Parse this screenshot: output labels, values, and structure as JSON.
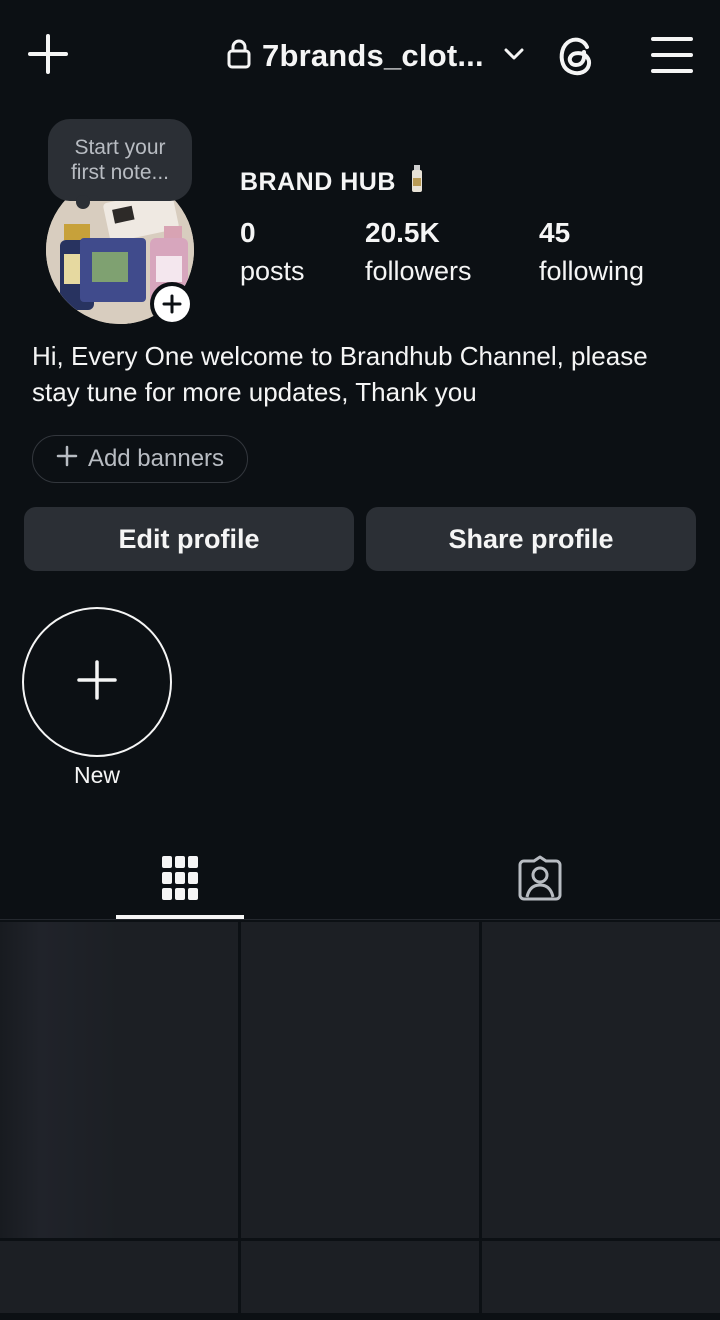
{
  "header": {
    "username": "7brands_clot...",
    "icons": [
      "plus-icon",
      "lock-icon",
      "chevron-down-icon",
      "threads-icon",
      "menu-icon"
    ]
  },
  "profile": {
    "note": "Start your first note...",
    "display_name": "BRAND HUB",
    "stats": [
      {
        "value": "0",
        "label": "posts"
      },
      {
        "value": "20.5K",
        "label": "followers"
      },
      {
        "value": "45",
        "label": "following"
      }
    ],
    "bio": "Hi, Every One welcome to Brandhub Channel, please stay tune for more updates, Thank you",
    "add_banners": "Add banners"
  },
  "actions": {
    "edit": "Edit profile",
    "share": "Share profile"
  },
  "highlights": {
    "new_label": "New"
  },
  "tabs": {
    "items": [
      "grid-icon",
      "tagged-icon"
    ],
    "active": "grid-icon"
  },
  "colors": {
    "background": "#0c1014",
    "button": "#2b2f35",
    "text": "#f5f5f5",
    "muted": "#b8bcc2"
  }
}
